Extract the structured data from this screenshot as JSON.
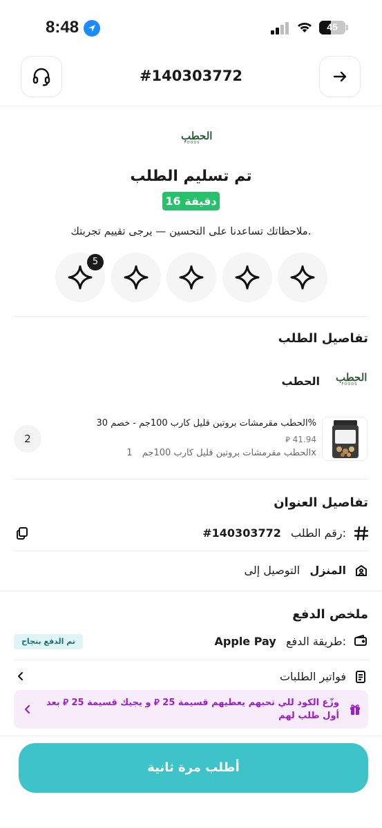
{
  "status_bar": {
    "time": "8:48",
    "battery": "45"
  },
  "header": {
    "order_number": "#140303772",
    "support_icon": "headset-icon",
    "back_icon": "arrow-right-icon"
  },
  "brand": {
    "logo_text": "الحطب",
    "logo_sub": "FOODS"
  },
  "delivery": {
    "title": "تم تسليم الطلب",
    "eta": "16 دقيقة",
    "feedback_prompt": "ملاحظاتك تساعدنا على التحسين — يرجى تقييم تجربتك.",
    "rating_count": "5",
    "stars": [
      "star",
      "star",
      "star",
      "star",
      "star"
    ]
  },
  "order_details": {
    "title": "تفاصيل الطلب",
    "store_name": "الحطب",
    "item": {
      "name": "الحطب مقرمشات بروتين قليل كارب 100جم - خصم 30%",
      "price": "41.94",
      "variant": "الحطب مقرمشات بروتين قليل كارب 100جم",
      "variant_qty": "1x",
      "quantity": "2"
    }
  },
  "address_details": {
    "title": "تفاصيل العنوان",
    "order_number_label": "رقم الطلب:",
    "order_number_value": "#140303772",
    "delivery_prefix": "التوصيل إلى",
    "delivery_place": "المنزل"
  },
  "payment": {
    "title": "ملخص الدفع",
    "method_label": "طريقة الدفع:",
    "method_value": "Apple Pay",
    "status": "تم الدفع بنجاح",
    "invoices_label": "فواتير الطلبات"
  },
  "promo": {
    "text": "وزّع الكود للي تحبهم يعطيهم قسيمة 25 ⃁ و يجيك قسيمة 25 ⃁ بعد أول طلب لهم"
  },
  "footer": {
    "reorder_label": "أطلب مرة ثانية"
  },
  "colors": {
    "green": "#27c06b",
    "teal": "#3ec3c8",
    "purple": "#9b1fc5"
  }
}
